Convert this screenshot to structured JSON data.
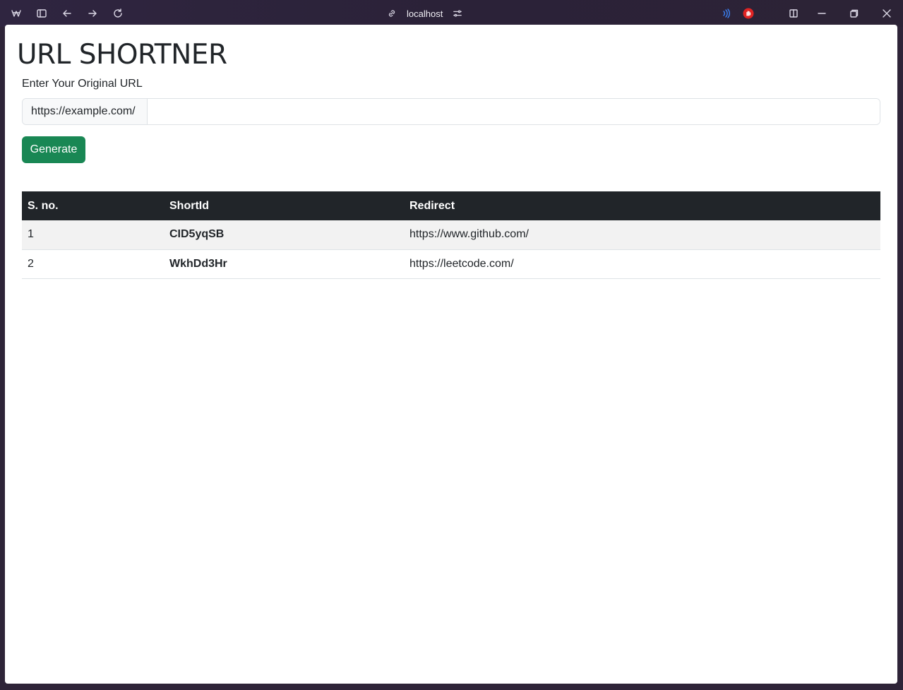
{
  "browser": {
    "address": "localhost",
    "icons": [
      "app-logo-icon",
      "sidebar-toggle-icon",
      "back-icon",
      "forward-icon",
      "reload-icon",
      "link-icon",
      "site-settings-icon",
      "read-aloud-icon",
      "adblock-icon",
      "split-view-icon",
      "minimize-icon",
      "restore-icon",
      "close-icon"
    ]
  },
  "page": {
    "title": "URL SHORTNER",
    "form": {
      "label": "Enter Your Original URL",
      "prefix": "https://example.com/",
      "value": "",
      "button": "Generate"
    },
    "table": {
      "headers": [
        "S. no.",
        "ShortId",
        "Redirect"
      ],
      "rows": [
        {
          "sno": "1",
          "shortid": "CID5yqSB",
          "redirect": "https://www.github.com/"
        },
        {
          "sno": "2",
          "shortid": "WkhDd3Hr",
          "redirect": "https://leetcode.com/"
        }
      ]
    }
  },
  "colors": {
    "primary_button": "#198754",
    "table_header": "#212529",
    "stripe": "#f2f2f2",
    "adblock": "#e02424",
    "read_aloud": "#3b82f6"
  }
}
